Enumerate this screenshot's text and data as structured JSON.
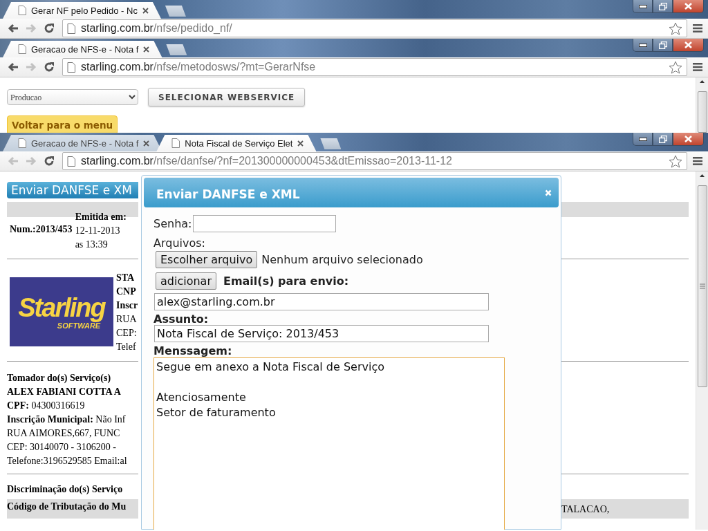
{
  "windows": [
    {
      "tabs": [
        {
          "title": "Gerar NF pelo Pedido - Nc",
          "selected": true
        }
      ],
      "url_host": "starling.com.br",
      "url_path": "/nfse/pedido_nf/",
      "back_enabled": true
    },
    {
      "tabs": [
        {
          "title": "Geracao de NFS-e - Nota f",
          "selected": true
        }
      ],
      "url_host": "starling.com.br",
      "url_path": "/nfse/metodosws/?mt=GerarNfse",
      "back_enabled": true,
      "page": {
        "kind": "webservice",
        "select_value": "Producao",
        "select_button": "SELECIONAR WEBSERVICE",
        "back_button": "Voltar para o menu"
      }
    },
    {
      "tabs": [
        {
          "title": "Geracao de NFS-e - Nota f",
          "selected": false
        },
        {
          "title": "Nota Fiscal de Serviço Elet",
          "selected": true
        }
      ],
      "url_host": "starling.com.br",
      "url_path": "/nfse/danfse/?nf=201300000000453&dtEmissao=2013-11-12",
      "back_enabled": false,
      "page": {
        "kind": "danfse",
        "header_title": "Enviar DANFSE e XM",
        "issued_label": "Emitida em:",
        "number": "Num.:2013/453",
        "issued_date": "12-11-2013",
        "issued_time": "as 13:39",
        "logo_text": "Starling",
        "logo_subtext": "SOFTWARE",
        "provider_lines": [
          {
            "text": "STA",
            "bold": true
          },
          {
            "text": "CNP",
            "bold": true
          },
          {
            "text": "Inscr",
            "bold": true
          },
          {
            "text": "RUA",
            "bold": false
          },
          {
            "text": "CEP:",
            "bold": false
          },
          {
            "text": "Telef",
            "bold": false
          }
        ],
        "taker_lines": [
          {
            "text": "Tomador do(s) Serviço(s)",
            "bold": true
          },
          {
            "text": "ALEX FABIANI COTTA A",
            "bold": true
          },
          {
            "text": "**CPF:** 04300316619",
            "bold": false
          },
          {
            "text": "**Inscrição Municipal:** Não Inf",
            "bold": false
          },
          {
            "text": "RUA AIMORES,667, FUNC",
            "bold": false
          },
          {
            "text": "CEP: 30140070 - 3106200 -",
            "bold": false
          },
          {
            "text": "Telefone:3196529585 Email:al",
            "bold": false
          }
        ],
        "services_heading": "Discriminação do(s) Serviço",
        "service_code_label": "Código de Tributação do Mu",
        "service_right_text": "TALACAO,",
        "dialog": {
          "title": "Enviar DANFSE e XML",
          "password_label": "Senha:",
          "files_label": "Arquivos:",
          "choose_button": "Escolher arquivo",
          "no_file": "Nenhum arquivo selecionado",
          "add_button": "adicionar",
          "emails_label": "Email(s) para envio:",
          "email_value": "alex@starling.com.br",
          "subject_label": "Assunto:",
          "subject_value": "Nota Fiscal de Serviço: 2013/453",
          "message_label": "Menssagem:",
          "message_value": "Segue em anexo a Nota Fiscal de Serviço\n\nAtenciosamente\nSetor de faturamento",
          "message_focused": true
        }
      }
    }
  ]
}
